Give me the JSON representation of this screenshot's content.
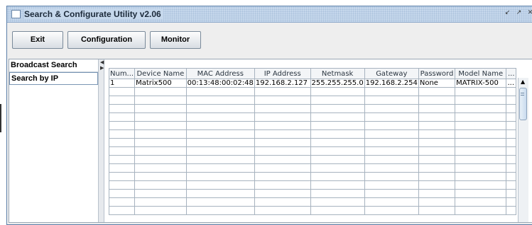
{
  "window": {
    "title": "Search & Configurate Utility  v2.06",
    "controls": [
      "minimize-icon",
      "maximize-icon",
      "close-icon"
    ]
  },
  "toolbar": {
    "exit_label": "Exit",
    "configuration_label": "Configuration",
    "monitor_label": "Monitor"
  },
  "sidebar": {
    "items": [
      {
        "label": "Broadcast Search"
      },
      {
        "label": "Search by IP"
      }
    ],
    "selected": "Search by IP"
  },
  "table": {
    "columns": [
      "Num...",
      "Device Name",
      "MAC Address",
      "IP Address",
      "Netmask",
      "Gateway",
      "Password",
      "Model Name",
      "..."
    ],
    "rows": [
      [
        "1",
        "Matrix500",
        "00:13:48:00:02:48",
        "192.168.2.127",
        "255.255.255.0",
        "192.168.2.254",
        "None",
        "MATRIX-500",
        "..."
      ]
    ],
    "empty_rows": 15
  },
  "colors": {
    "titlebar": "#c6d8ec",
    "border": "#5a7ea8",
    "background": "#eeeeee"
  }
}
